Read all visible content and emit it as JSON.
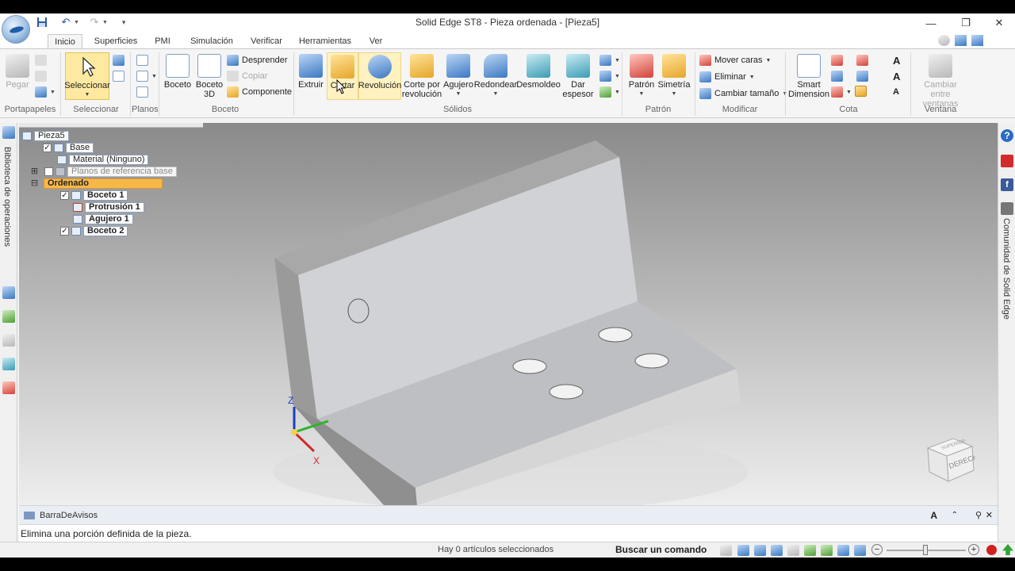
{
  "window": {
    "title": "Solid Edge ST8 - Pieza ordenada - [Pieza5]"
  },
  "icons": {
    "app_menu": "solid-edge-logo",
    "save": "save-icon",
    "undo": "undo-icon",
    "redo": "redo-icon",
    "minimize": "minimize-icon",
    "restore": "restore-icon",
    "close": "close-icon",
    "help": "help-icon"
  },
  "tabs": [
    "Inicio",
    "Superficies",
    "PMI",
    "Simulación",
    "Verificar",
    "Herramientas",
    "Ver"
  ],
  "active_tab": "Inicio",
  "ribbon": {
    "portapapeles": {
      "label": "Portapapeles",
      "pegar": "Pegar"
    },
    "seleccionar": {
      "label": "Seleccionar",
      "seleccionar": "Seleccionar"
    },
    "planos": {
      "label": "Planos"
    },
    "boceto": {
      "label": "Boceto",
      "boceto": "Boceto",
      "boceto3d_l1": "Boceto",
      "boceto3d_l2": "3D",
      "desprender": "Desprender",
      "copiar": "Copiar",
      "componente": "Componente"
    },
    "solidos": {
      "label": "Sólidos",
      "extruir": "Extruir",
      "cortar": "Cortar",
      "revolucion": "Revolución",
      "corte_revolucion_l1": "Corte por",
      "corte_revolucion_l2": "revolución",
      "agujero": "Agujero",
      "redondear": "Redondear",
      "desmoldeo": "Desmoldeo",
      "dar_espesor_l1": "Dar",
      "dar_espesor_l2": "espesor"
    },
    "patron": {
      "label": "Patrón",
      "patron": "Patrón",
      "simetria": "Simetría"
    },
    "modificar": {
      "label": "Modificar",
      "mover_caras": "Mover caras",
      "eliminar": "Eliminar",
      "cambiar_tamano": "Cambiar tamaño"
    },
    "cota": {
      "label": "Cota",
      "smart_l1": "Smart",
      "smart_l2": "Dimension"
    },
    "ventana": {
      "label": "Ventana",
      "cambiar_l1": "Cambiar entre",
      "cambiar_l2": "ventanas"
    }
  },
  "left_panel": {
    "label": "Biblioteca de operaciones"
  },
  "right_panel": {
    "label": "Comunidad de Solid Edge"
  },
  "tree": {
    "root": "Pieza5",
    "base": "Base",
    "material": "Material (Ninguno)",
    "planos": "Planos de referencia base",
    "ordenado": "Ordenado",
    "boceto1": "Boceto 1",
    "protrusion1": "Protrusión 1",
    "agujero1": "Agujero 1",
    "boceto2": "Boceto 2"
  },
  "axis": {
    "z": "Z",
    "x": "X"
  },
  "nav_cube": {
    "front": "DERECHA",
    "top": "SUPERIOR"
  },
  "message_bar": {
    "title": "BarraDeAvisos",
    "message": "Elimina una porción definida de la pieza."
  },
  "status": {
    "selection": "Hay 0 artículos seleccionados",
    "search_label": "Buscar un comando"
  }
}
